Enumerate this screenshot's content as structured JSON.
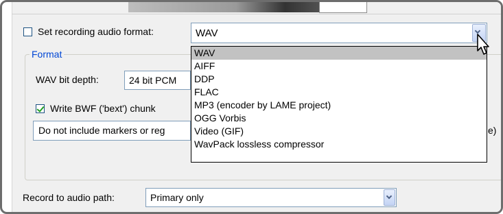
{
  "recording": {
    "set_format_label": "Set recording audio format:",
    "set_format_checked": false,
    "format_value": "WAV"
  },
  "format_group": {
    "title": "Format",
    "bit_depth_label": "WAV bit depth:",
    "bit_depth_value": "24 bit PCM",
    "bwf_label": "Write BWF ('bext') chunk",
    "bwf_checked": true,
    "markers_value": "Do not include markers or reg",
    "markers_right_fragment": "e)"
  },
  "dropdown": {
    "options": [
      "WAV",
      "AIFF",
      "DDP",
      "FLAC",
      "MP3 (encoder by LAME project)",
      "OGG Vorbis",
      "Video (GIF)",
      "WavPack lossless compressor"
    ],
    "selected": "WAV"
  },
  "record_path": {
    "label": "Record to audio path:",
    "value": "Primary only"
  },
  "icons": [
    "chevron-down-icon",
    "checkmark-icon",
    "mouse-cursor-icon"
  ]
}
